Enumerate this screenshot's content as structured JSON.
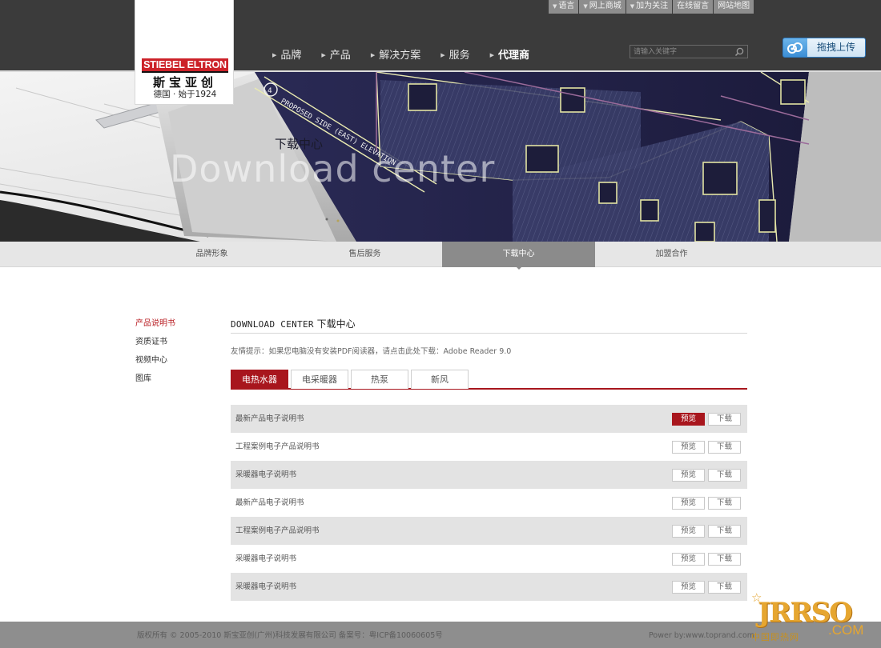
{
  "colors": {
    "header_bg": "#3b3b3b",
    "brand_red": "#a8161d",
    "logo_red": "#cc2229",
    "subnav_bg": "#e6e6e6",
    "subnav_active": "#8b8b8b",
    "row_shade": "#e3e3e3",
    "footer_bg": "#8e8e8e",
    "upload_blue": "#3c8ed5"
  },
  "top_links": [
    {
      "label": "语言",
      "icon": "triangle-down-icon"
    },
    {
      "label": "网上商城",
      "icon": "triangle-down-icon"
    },
    {
      "label": "加为关注",
      "icon": "triangle-down-icon"
    },
    {
      "label": "在线留言",
      "icon": null
    },
    {
      "label": "网站地图",
      "icon": null
    }
  ],
  "logo": {
    "en": "STIEBEL ELTRON",
    "cn": "斯宝亚创",
    "tagline": "德国 · 始于1924"
  },
  "main_nav": [
    {
      "label": "品牌",
      "active": false
    },
    {
      "label": "产品",
      "active": false
    },
    {
      "label": "解决方案",
      "active": false
    },
    {
      "label": "服务",
      "active": false
    },
    {
      "label": "代理商",
      "active": true
    }
  ],
  "search": {
    "placeholder": "请输入关键字",
    "icon": "search-icon"
  },
  "upload": {
    "label": "拖拽上传",
    "icon": "cloud-link-icon"
  },
  "banner": {
    "title_cn": "下载中心",
    "title_en": "Download center",
    "drawing_label": "PROPOSED SIDE (EAST) ELEVATION",
    "drawing_number": "4"
  },
  "sub_nav": [
    {
      "label": "品牌形象",
      "active": false
    },
    {
      "label": "售后服务",
      "active": false
    },
    {
      "label": "下载中心",
      "active": true
    },
    {
      "label": "加盟合作",
      "active": false
    }
  ],
  "sidebar": [
    {
      "label": "产品说明书",
      "active": true
    },
    {
      "label": "资质证书",
      "active": false
    },
    {
      "label": "视频中心",
      "active": false
    },
    {
      "label": "图库",
      "active": false
    }
  ],
  "content": {
    "title_en": "DOWNLOAD CENTER",
    "title_cn": "下载中心",
    "tip_prefix": "友情提示：如果您电脑没有安装PDF阅读器，请点击此处下载：",
    "tip_link": "Adobe Reader 9.0"
  },
  "tabs": [
    {
      "label": "电热水器",
      "active": true
    },
    {
      "label": "电采暖器",
      "active": false
    },
    {
      "label": "热泵",
      "active": false
    },
    {
      "label": "新风",
      "active": false
    }
  ],
  "files": [
    {
      "title": "最新产品电子说明书",
      "preview": "预览",
      "download": "下载",
      "shaded": true,
      "preview_highlight": true
    },
    {
      "title": "工程案例电子产品说明书",
      "preview": "预览",
      "download": "下载",
      "shaded": false,
      "preview_highlight": false
    },
    {
      "title": "采暖器电子说明书",
      "preview": "预览",
      "download": "下载",
      "shaded": true,
      "preview_highlight": false
    },
    {
      "title": "最新产品电子说明书",
      "preview": "预览",
      "download": "下载",
      "shaded": false,
      "preview_highlight": false
    },
    {
      "title": "工程案例电子产品说明书",
      "preview": "预览",
      "download": "下载",
      "shaded": true,
      "preview_highlight": false
    },
    {
      "title": "采暖器电子说明书",
      "preview": "预览",
      "download": "下载",
      "shaded": false,
      "preview_highlight": false
    },
    {
      "title": "采暖器电子说明书",
      "preview": "预览",
      "download": "下载",
      "shaded": true,
      "preview_highlight": false
    }
  ],
  "footer": {
    "copyright": "版权所有 © 2005-2010 斯宝亚创(广州)科技发展有限公司 备案号：粤ICP备10060605号",
    "powered": "Power by:www.toprand.com"
  },
  "watermark": {
    "brand": "JRRSO",
    "suffix": ".COM",
    "cn": "中国即热网"
  }
}
